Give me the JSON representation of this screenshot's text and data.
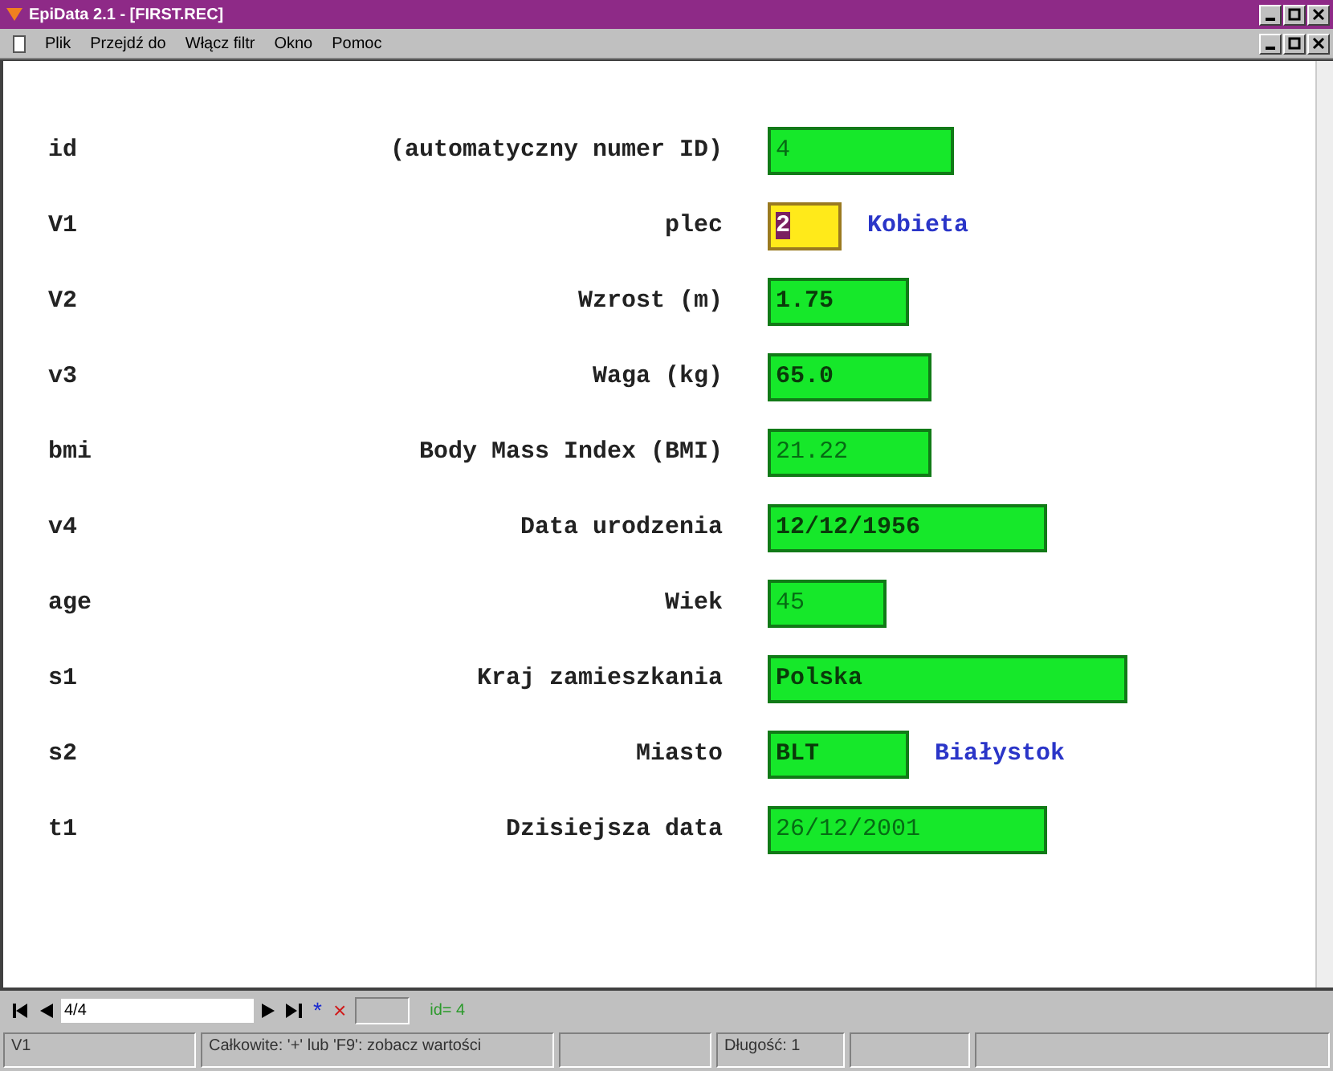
{
  "window": {
    "title": "EpiData 2.1 - [FIRST.REC]"
  },
  "menu": [
    "Plik",
    "Przejdź do",
    "Włącz filtr",
    "Okno",
    "Pomoc"
  ],
  "fields": [
    {
      "name": "id",
      "label": "(automatyczny numer ID)",
      "value": "4",
      "kind": "readonly",
      "selected": false
    },
    {
      "name": "V1",
      "label": "plec",
      "value": "2",
      "value_label": "Kobieta",
      "kind": "editable",
      "selected": true
    },
    {
      "name": "V2",
      "label": "Wzrost (m)",
      "value": "1.75",
      "kind": "editable",
      "selected": false
    },
    {
      "name": "v3",
      "label": "Waga (kg)",
      "value": "65.0",
      "kind": "editable",
      "selected": false
    },
    {
      "name": "bmi",
      "label": "Body Mass Index (BMI)",
      "value": "21.22",
      "kind": "readonly",
      "selected": false
    },
    {
      "name": "v4",
      "label": "Data urodzenia",
      "value": "12/12/1956",
      "kind": "editable",
      "selected": false
    },
    {
      "name": "age",
      "label": "Wiek",
      "value": "45",
      "kind": "readonly",
      "selected": false
    },
    {
      "name": "s1",
      "label": "Kraj zamieszkania",
      "value": "Polska",
      "kind": "editable",
      "selected": false
    },
    {
      "name": "s2",
      "label": "Miasto",
      "value": "BLT",
      "value_label": "Białystok",
      "kind": "editable",
      "selected": false
    },
    {
      "name": "t1",
      "label": "Dzisiejsza data",
      "value": "26/12/2001",
      "kind": "readonly",
      "selected": false
    }
  ],
  "navigator": {
    "record": "4/4",
    "new_mark": "*",
    "delete_mark": "×",
    "filter": "id= 4"
  },
  "status_bar": {
    "field": "V1",
    "hint": "Całkowite: '+' lub 'F9': zobacz wartości",
    "length": "Długość: 1"
  }
}
